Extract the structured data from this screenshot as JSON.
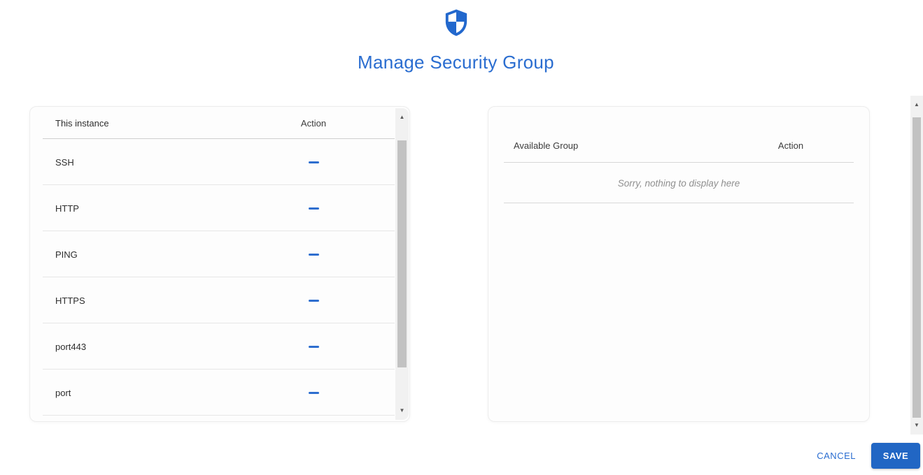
{
  "colors": {
    "accent_button": "#2166c4",
    "title_blue": "#2a6dd0",
    "minus_blue": "#2e6ecf",
    "scrollbar_track": "#f1f1f1",
    "scrollbar_thumb": "#c2c2c2"
  },
  "header": {
    "icon": "shield-icon",
    "title": "Manage Security Group"
  },
  "instance_panel": {
    "col_instance": "This instance",
    "col_action": "Action",
    "rows": [
      {
        "name": "SSH"
      },
      {
        "name": "HTTP"
      },
      {
        "name": "PING"
      },
      {
        "name": "HTTPS"
      },
      {
        "name": "port443"
      },
      {
        "name": "port"
      }
    ]
  },
  "available_panel": {
    "col_group": "Available Group",
    "col_action": "Action",
    "empty_message": "Sorry, nothing to display here"
  },
  "footer": {
    "cancel": "CANCEL",
    "save": "SAVE"
  },
  "icons": {
    "scroll_up_glyph": "▲",
    "scroll_down_glyph": "▼"
  }
}
